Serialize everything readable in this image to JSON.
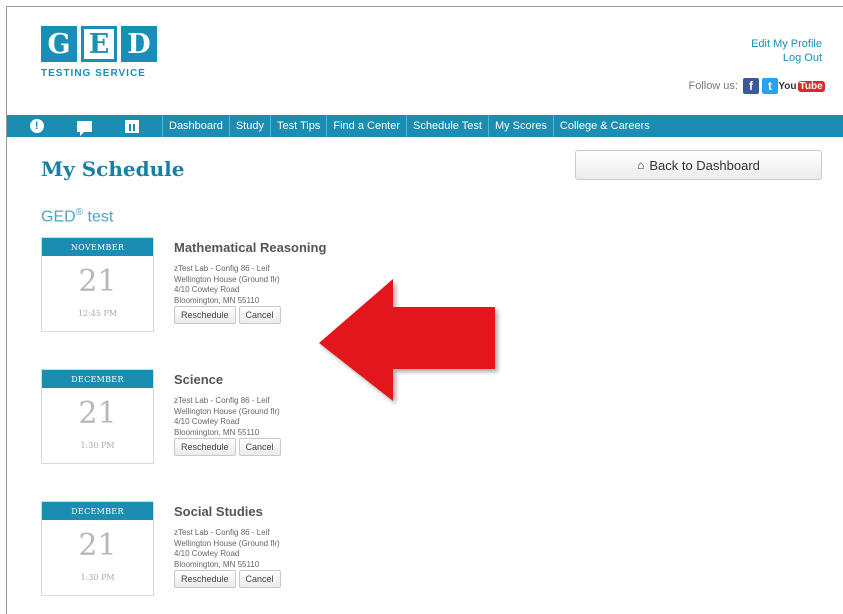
{
  "header": {
    "logo_letters": [
      "G",
      "E",
      "D"
    ],
    "logo_subtitle": "TESTING SERVICE",
    "edit_profile": "Edit My Profile",
    "log_out": "Log Out",
    "follow_label": "Follow us:",
    "social": [
      {
        "name": "facebook",
        "glyph": "f"
      },
      {
        "name": "twitter",
        "glyph": "t"
      },
      {
        "name": "youtube",
        "glyph_a": "You",
        "glyph_b": "Tube"
      }
    ]
  },
  "nav": {
    "icons": [
      "alert-icon",
      "chat-icon",
      "calendar-icon"
    ],
    "items": [
      "Dashboard",
      "Study",
      "Test Tips",
      "Find a Center",
      "Schedule Test",
      "My Scores",
      "College & Careers"
    ]
  },
  "page": {
    "title": "My Schedule",
    "back_button": "Back to Dashboard",
    "section_title": "GED",
    "section_sup": "®",
    "section_suffix": " test"
  },
  "schedule": [
    {
      "month": "NOVEMBER",
      "day": "21",
      "time": "12:45 PM",
      "subject": "Mathematical Reasoning",
      "address": [
        "zTest Lab - Config 86 - Leif",
        "Wellington House (Ground flr)",
        "4/10 Cowley Road",
        "Bloomington, MN 55110"
      ],
      "reschedule": "Reschedule",
      "cancel": "Cancel"
    },
    {
      "month": "DECEMBER",
      "day": "21",
      "time": "1:30 PM",
      "subject": "Science",
      "address": [
        "zTest Lab - Config 86 - Leif",
        "Wellington House (Ground flr)",
        "4/10 Cowley Road",
        "Bloomington, MN 55110"
      ],
      "reschedule": "Reschedule",
      "cancel": "Cancel"
    },
    {
      "month": "DECEMBER",
      "day": "21",
      "time": "1:30 PM",
      "subject": "Social Studies",
      "address": [
        "zTest Lab - Config 86 - Leif",
        "Wellington House (Ground flr)",
        "4/10 Cowley Road",
        "Bloomington, MN 55110"
      ],
      "reschedule": "Reschedule",
      "cancel": "Cancel"
    }
  ],
  "colors": {
    "brand": "#1a8fb6",
    "nav_bg": "#1b8db3",
    "title": "#1a7ea5",
    "arrow": "#e3141b"
  }
}
